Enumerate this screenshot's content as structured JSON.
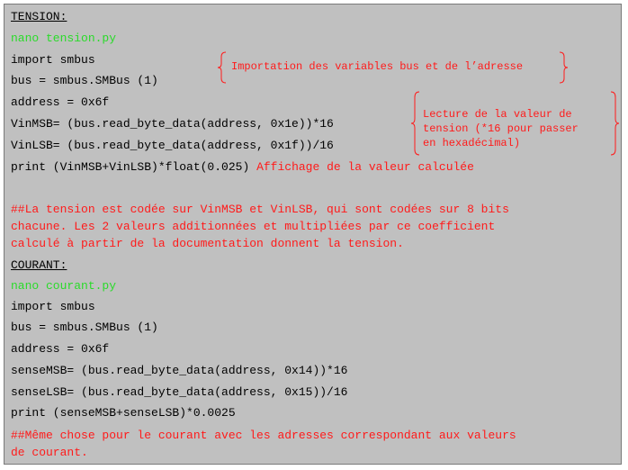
{
  "tension": {
    "heading": "TENSION:",
    "command": "nano tension.py",
    "lines": [
      "import smbus",
      "bus = smbus.SMBus (1)",
      "address = 0x6f",
      "VinMSB= (bus.read_byte_data(address, 0x1e))*16",
      "VinLSB= (bus.read_byte_data(address, 0x1f))/16",
      "print (VinMSB+VinLSB)*float(0.025)"
    ],
    "print_comment": "Affichage de la valeur calculée",
    "note_import": "Importation des variables bus et de l’adresse",
    "note_read": [
      "Lecture de la valeur de",
      "tension (*16 pour passer",
      "en hexadécimal)"
    ],
    "comment": [
      "##La tension est codée sur VinMSB et VinLSB, qui sont codées sur 8 bits",
      "chacune. Les 2 valeurs additionnées et multipliées par ce coefficient",
      "calculé à partir de la documentation donnent la tension."
    ]
  },
  "courant": {
    "heading": "COURANT:",
    "command": "nano courant.py",
    "lines": [
      "import smbus",
      "bus = smbus.SMBus (1)",
      "address = 0x6f",
      "senseMSB= (bus.read_byte_data(address, 0x14))*16",
      "senseLSB= (bus.read_byte_data(address, 0x15))/16",
      "print (senseMSB+senseLSB)*0.0025"
    ],
    "comment": [
      "##Même chose pour le courant avec les adresses correspondant aux valeurs",
      "de courant."
    ]
  },
  "colors": {
    "background": "#c0c0c0",
    "command": "#2adb2a",
    "comment": "#ff1a1a",
    "code": "#000000"
  }
}
